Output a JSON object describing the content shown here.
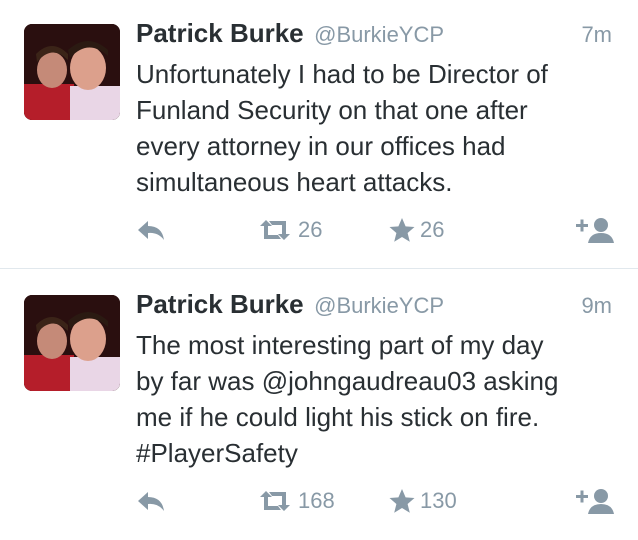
{
  "tweets": [
    {
      "name": "Patrick Burke",
      "handle": "@BurkieYCP",
      "time": "7m",
      "text": "Unfortunately I had to be Director of\nFunland Security on that one after\nevery attorney in our offices had\nsimultaneous heart attacks.",
      "retweets": "26",
      "favorites": "26"
    },
    {
      "name": "Patrick Burke",
      "handle": "@BurkieYCP",
      "time": "9m",
      "text": "The most interesting part of my day\nby far was @johngaudreau03 asking\nme if he could light his stick on fire.\n#PlayerSafety",
      "retweets": "168",
      "favorites": "130"
    }
  ],
  "icons": {
    "reply": "reply-icon",
    "retweet": "retweet-icon",
    "favorite": "star-icon",
    "follow": "add-user-icon"
  },
  "colors": {
    "text": "#292f33",
    "muted": "#8899a6",
    "divider": "#e1e8ed"
  }
}
